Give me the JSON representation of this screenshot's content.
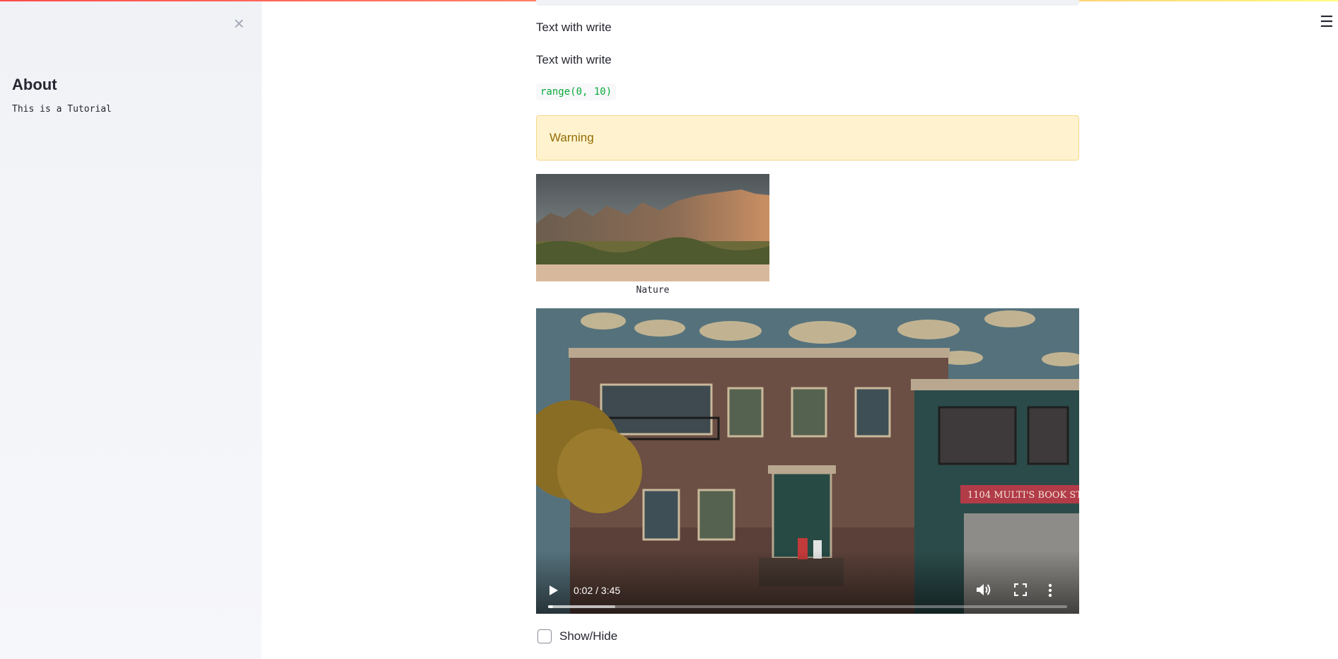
{
  "sidebar": {
    "close_icon": "×",
    "title": "About",
    "text": "This is a Tutorial"
  },
  "header": {
    "menu_icon": "☰"
  },
  "main": {
    "line1": "Text with write",
    "line2": "Text with write",
    "code": "range(0, 10)",
    "warning": "Warning",
    "image_caption": "Nature",
    "video": {
      "time": "0:02 / 3:45",
      "sign_text": "1104 MULTI'S BOOK ST",
      "played_fraction": 0.009,
      "buffered_fraction": 0.13
    },
    "checkbox_label": "Show/Hide",
    "checkbox_checked": false
  },
  "colors": {
    "accent": "#ff4b4b",
    "warning_bg": "#fff3cf",
    "warning_text": "#926c05",
    "code_text": "#09ab3b"
  }
}
